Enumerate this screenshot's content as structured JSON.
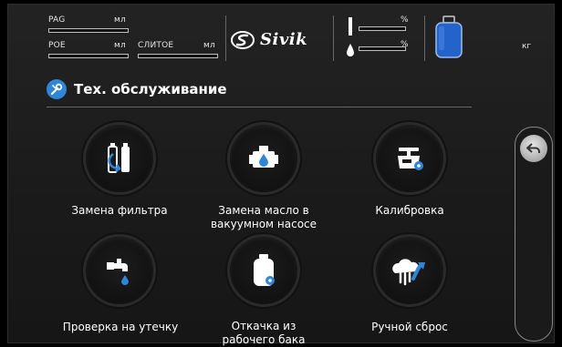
{
  "header": {
    "pag_label": "PAG",
    "pag_unit": "мл",
    "poe_label": "POE",
    "poe_unit": "мл",
    "drain_label": "СЛИТОЕ",
    "drain_unit": "мл",
    "brand": "Sivik",
    "pct1": "%",
    "pct2": "%",
    "tank_unit": "кг"
  },
  "page_title": "Тех. обслуживание",
  "tiles": [
    {
      "label": "Замена фильтра",
      "icon": "filter-replace-icon"
    },
    {
      "label": "Замена масло в\nвакуумном насосе",
      "icon": "vacuum-pump-oil-icon"
    },
    {
      "label": "Калибровка",
      "icon": "scale-calibration-icon"
    },
    {
      "label": "Проверка на утечку",
      "icon": "leak-test-icon"
    },
    {
      "label": "Откачка из\nрабочего бака",
      "icon": "tank-evacuation-icon"
    },
    {
      "label": "Ручной сброс",
      "icon": "manual-release-icon"
    }
  ],
  "colors": {
    "accent_blue": "#2f86d6",
    "tank_blue": "#2463c9"
  }
}
